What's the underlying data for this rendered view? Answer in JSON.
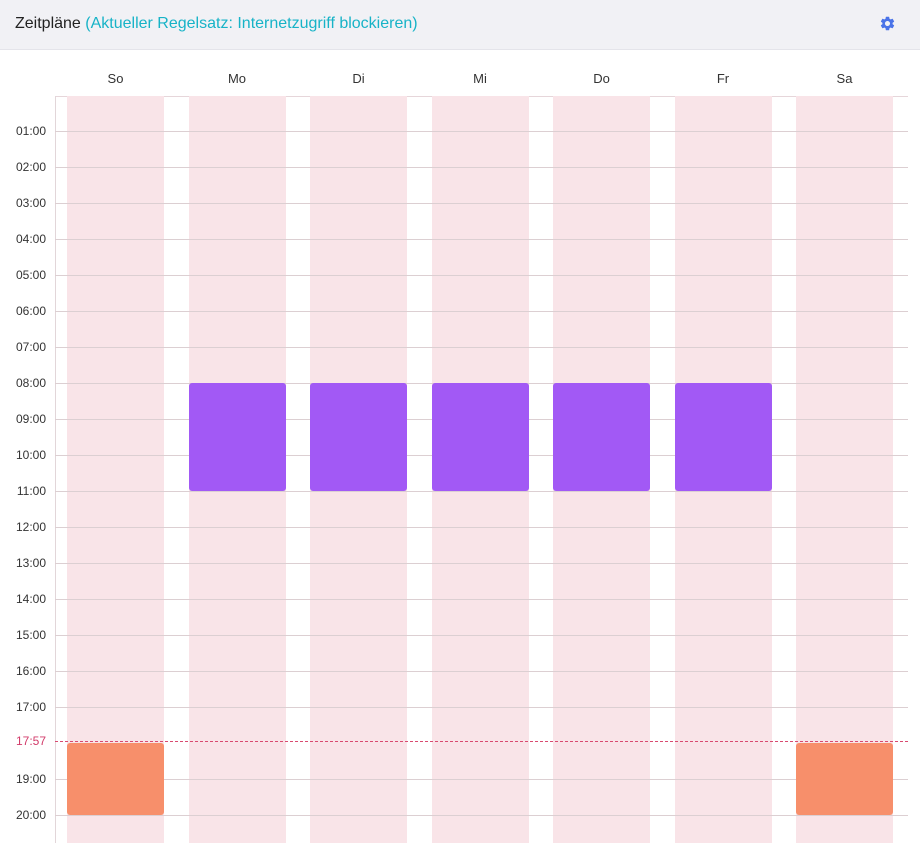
{
  "header": {
    "title": "Zeitpläne",
    "subtitle": "(Aktueller Regelsatz: Internetzugriff blockieren)",
    "settings_icon": "gear-icon",
    "accent_color": "#17b3c7"
  },
  "schedule": {
    "days": [
      "So",
      "Mo",
      "Di",
      "Mi",
      "Do",
      "Fr",
      "Sa"
    ],
    "hour_labels": [
      {
        "label": "01:00",
        "hour": 1
      },
      {
        "label": "02:00",
        "hour": 2
      },
      {
        "label": "03:00",
        "hour": 3
      },
      {
        "label": "04:00",
        "hour": 4
      },
      {
        "label": "05:00",
        "hour": 5
      },
      {
        "label": "06:00",
        "hour": 6
      },
      {
        "label": "07:00",
        "hour": 7
      },
      {
        "label": "08:00",
        "hour": 8
      },
      {
        "label": "09:00",
        "hour": 9
      },
      {
        "label": "10:00",
        "hour": 10
      },
      {
        "label": "11:00",
        "hour": 11
      },
      {
        "label": "12:00",
        "hour": 12
      },
      {
        "label": "13:00",
        "hour": 13
      },
      {
        "label": "14:00",
        "hour": 14
      },
      {
        "label": "15:00",
        "hour": 15
      },
      {
        "label": "16:00",
        "hour": 16
      },
      {
        "label": "17:00",
        "hour": 17
      },
      {
        "label": "19:00",
        "hour": 19
      },
      {
        "label": "20:00",
        "hour": 20
      }
    ],
    "current_time": {
      "label": "17:57",
      "hour": 17.95
    },
    "column_color": "#f9e4e8",
    "blocks": [
      {
        "day": 1,
        "start": 8,
        "end": 11,
        "color": "#a259f5"
      },
      {
        "day": 2,
        "start": 8,
        "end": 11,
        "color": "#a259f5"
      },
      {
        "day": 3,
        "start": 8,
        "end": 11,
        "color": "#a259f5"
      },
      {
        "day": 4,
        "start": 8,
        "end": 11,
        "color": "#a259f5"
      },
      {
        "day": 5,
        "start": 8,
        "end": 11,
        "color": "#a259f5"
      },
      {
        "day": 0,
        "start": 18,
        "end": 20,
        "color": "#f78f6b"
      },
      {
        "day": 6,
        "start": 18,
        "end": 20,
        "color": "#f78f6b"
      }
    ]
  }
}
